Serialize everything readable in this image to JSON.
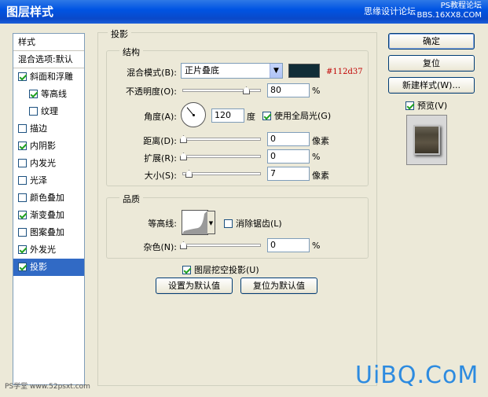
{
  "window": {
    "title": "图层样式",
    "watermark_line1": "PS教程论坛",
    "watermark_line2": "BBS.16XX8.COM",
    "watermark_mid": "思缘设计论坛"
  },
  "left_list": {
    "header": "样式",
    "blend": "混合选项:默认",
    "items": [
      {
        "label": "斜面和浮雕",
        "checked": true,
        "indent": false,
        "selected": false
      },
      {
        "label": "等高线",
        "checked": true,
        "indent": true,
        "selected": false
      },
      {
        "label": "纹理",
        "checked": false,
        "indent": true,
        "selected": false
      },
      {
        "label": "描边",
        "checked": false,
        "indent": false,
        "selected": false
      },
      {
        "label": "内阴影",
        "checked": true,
        "indent": false,
        "selected": false
      },
      {
        "label": "内发光",
        "checked": false,
        "indent": false,
        "selected": false
      },
      {
        "label": "光泽",
        "checked": false,
        "indent": false,
        "selected": false
      },
      {
        "label": "颜色叠加",
        "checked": false,
        "indent": false,
        "selected": false
      },
      {
        "label": "渐变叠加",
        "checked": true,
        "indent": false,
        "selected": false
      },
      {
        "label": "图案叠加",
        "checked": false,
        "indent": false,
        "selected": false
      },
      {
        "label": "外发光",
        "checked": true,
        "indent": false,
        "selected": false
      },
      {
        "label": "投影",
        "checked": true,
        "indent": false,
        "selected": true
      }
    ]
  },
  "shadow": {
    "section_title": "投影",
    "structure_title": "结构",
    "blend_mode_label": "混合模式(B):",
    "blend_mode_value": "正片叠底",
    "color_hex": "#112d37",
    "color_annotation": "#112d37",
    "opacity_label": "不透明度(O):",
    "opacity_value": "80",
    "opacity_level": 0.8,
    "opacity_unit": "%",
    "angle_label": "角度(A):",
    "angle_value": "120",
    "angle_unit": "度",
    "global_light_label": "使用全局光(G)",
    "global_light_checked": true,
    "distance_label": "距离(D):",
    "distance_value": "0",
    "distance_unit": "像素",
    "spread_label": "扩展(R):",
    "spread_value": "0",
    "spread_unit": "%",
    "size_label": "大小(S):",
    "size_value": "7",
    "size_unit": "像素",
    "quality_title": "品质",
    "contour_label": "等高线:",
    "antialias_label": "消除锯齿(L)",
    "antialias_checked": false,
    "noise_label": "杂色(N):",
    "noise_value": "0",
    "noise_unit": "%",
    "knockout_label": "图层挖空投影(U)",
    "knockout_checked": true,
    "set_default_label": "设置为默认值",
    "reset_default_label": "复位为默认值"
  },
  "buttons": {
    "ok": "确定",
    "reset": "复位",
    "new_style": "新建样式(W)...",
    "preview_label": "预览(V)",
    "preview_checked": true
  },
  "footer": {
    "left_watermark": "PS学堂 www.52psxt.com",
    "big_watermark": "UiBQ.CoM"
  }
}
